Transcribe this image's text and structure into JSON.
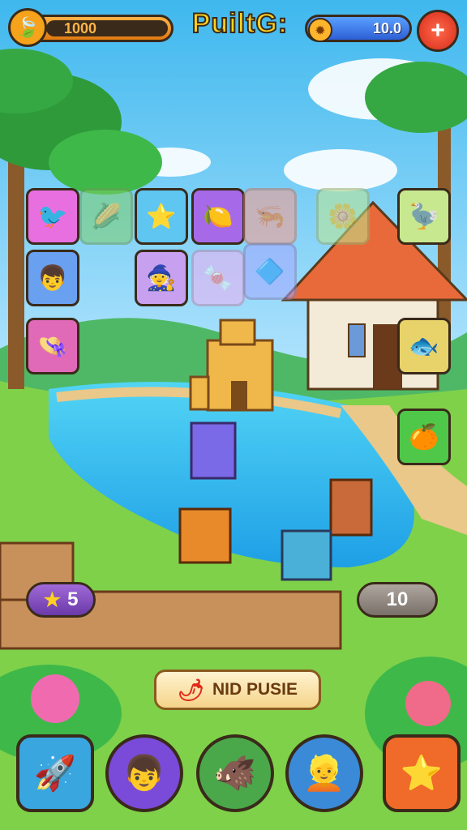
{
  "hud": {
    "coins": "1000",
    "title": "PuiltG:",
    "gems": "10.0",
    "coin_icon": "leaf-icon",
    "gem_icon": "sun-gem-icon",
    "plus_icon": "plus-icon"
  },
  "tiles": [
    {
      "name": "tile-bird",
      "glyph": "🐦",
      "color": "#e76fe0",
      "faded": false
    },
    {
      "name": "tile-purple-corn",
      "glyph": "🌽",
      "color": "#7ecf6a",
      "faded": true
    },
    {
      "name": "tile-starfish",
      "glyph": "⭐",
      "color": "#5ec6f0",
      "faded": false
    },
    {
      "name": "tile-lemon-face",
      "glyph": "🍋",
      "color": "#a66ae8",
      "faded": false
    },
    {
      "name": "tile-sea-items",
      "glyph": "🦐",
      "color": "#ff9a8a",
      "faded": true
    },
    {
      "name": "tile-flower",
      "glyph": "🌼",
      "color": "#bfe890",
      "faded": true
    },
    {
      "name": "tile-bird-right",
      "glyph": "🦤",
      "color": "#c8e890",
      "faded": false
    },
    {
      "name": "tile-blue-boy",
      "glyph": "👦",
      "color": "#6aa0f0",
      "faded": false
    },
    {
      "name": "tile-pink-hat",
      "glyph": "🧙",
      "color": "#c8a0f0",
      "faded": false
    },
    {
      "name": "tile-pink-sweet",
      "glyph": "🍬",
      "color": "#f2b0f2",
      "faded": true
    },
    {
      "name": "tile-blue-crystal",
      "glyph": "🔷",
      "color": "#a7a7ff",
      "faded": true
    },
    {
      "name": "tile-red-hat",
      "glyph": "👒",
      "color": "#e06ab8",
      "faded": false
    },
    {
      "name": "tile-fish-gold",
      "glyph": "🐟",
      "color": "#e8d26a",
      "faded": false
    },
    {
      "name": "tile-orange-face",
      "glyph": "🍊",
      "color": "#4fc84a",
      "faded": false
    }
  ],
  "counters": {
    "left_value": "5",
    "left_icon": "star-icon",
    "right_value": "10"
  },
  "hint": {
    "label": "NID PUSIE",
    "icon": "chili-icon"
  },
  "bottom_bar": [
    {
      "name": "rocket-button",
      "glyph": "🚀",
      "color": "#3aa6e0",
      "shape": "sq"
    },
    {
      "name": "avatar-blue-cap",
      "glyph": "👦",
      "color": "#7a4ad8",
      "shape": "rd"
    },
    {
      "name": "avatar-boar",
      "glyph": "🐗",
      "color": "#4aa84a",
      "shape": "rd"
    },
    {
      "name": "avatar-blonde",
      "glyph": "👱",
      "color": "#3a8ad8",
      "shape": "rd"
    },
    {
      "name": "star-button",
      "glyph": "⭐",
      "color": "#f06a2a",
      "shape": "sq"
    }
  ]
}
